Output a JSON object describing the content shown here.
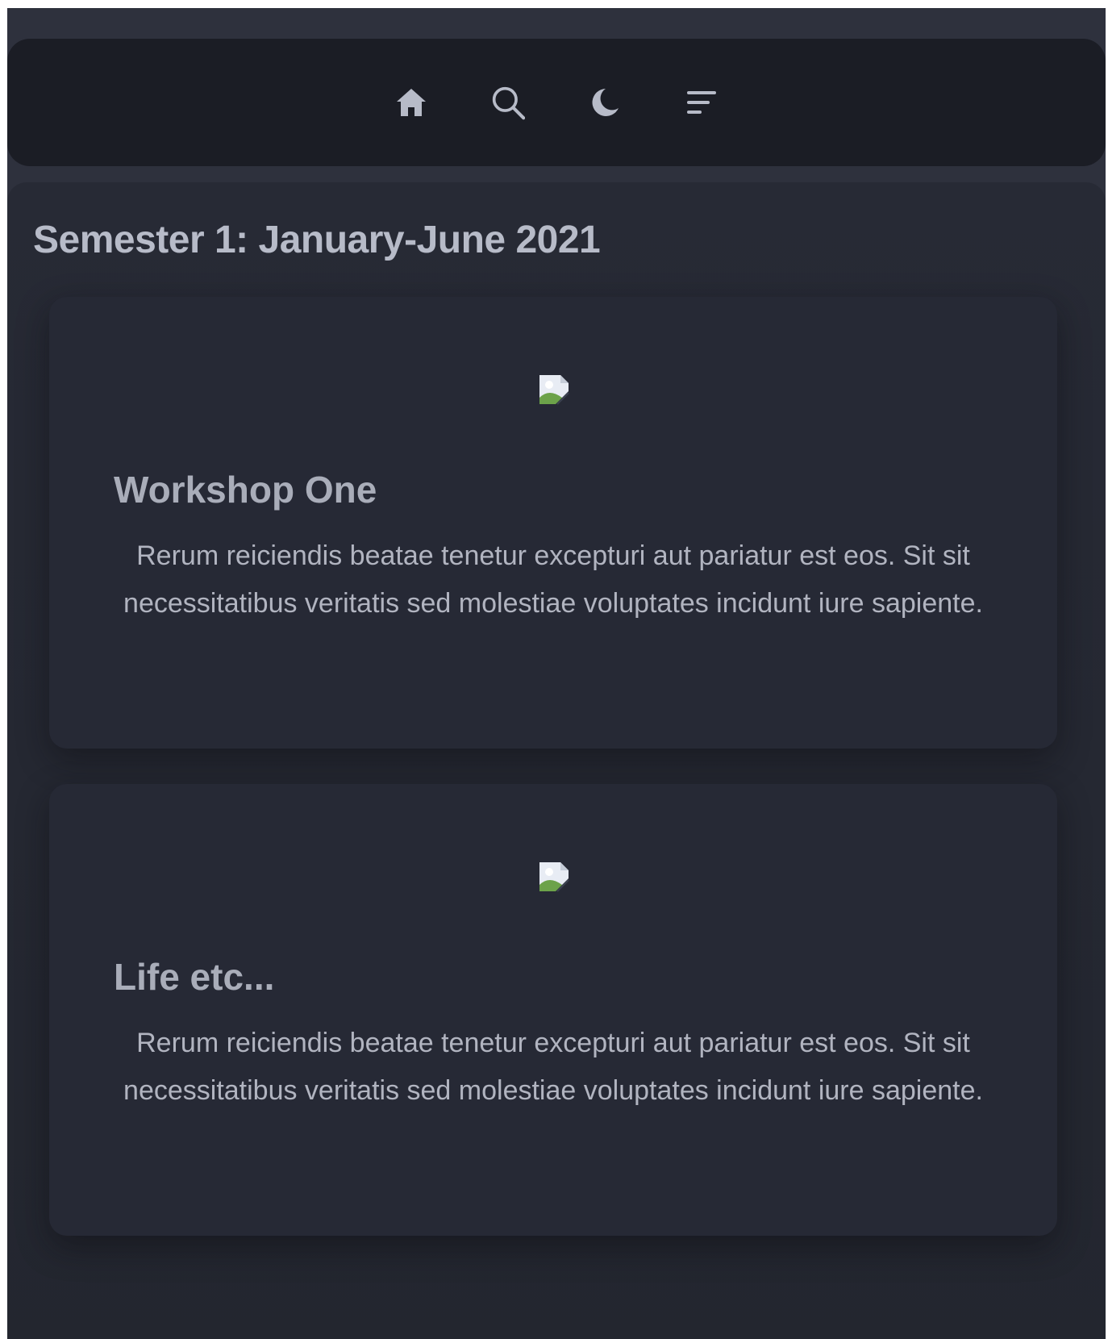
{
  "navbar": {
    "items": [
      {
        "icon": "home-icon",
        "label": ""
      },
      {
        "icon": "search-icon",
        "label": ""
      },
      {
        "icon": "moon-icon",
        "label": ""
      },
      {
        "icon": "menu-icon",
        "label": ""
      }
    ],
    "icon_color": "#b7bbc8"
  },
  "section": {
    "title": "Semester 1: January-June 2021"
  },
  "cards": [
    {
      "title": "Workshop One",
      "text": "Rerum reiciendis beatae tenetur excepturi aut pariatur est eos. Sit sit necessitatibus veritatis sed molestiae voluptates incidunt iure sapiente.",
      "image": "broken-image-icon"
    },
    {
      "title": "Life etc...",
      "text": "Rerum reiciendis beatae tenetur excepturi aut pariatur est eos. Sit sit necessitatibus veritatis sed molestiae voluptates incidunt iure sapiente.",
      "image": "broken-image-icon"
    }
  ],
  "colors": {
    "background": "#2e313d",
    "navbar": "#1b1d25",
    "card": "#262935",
    "title_text": "#b7bbc8",
    "body_text": "#b1b4c0"
  }
}
